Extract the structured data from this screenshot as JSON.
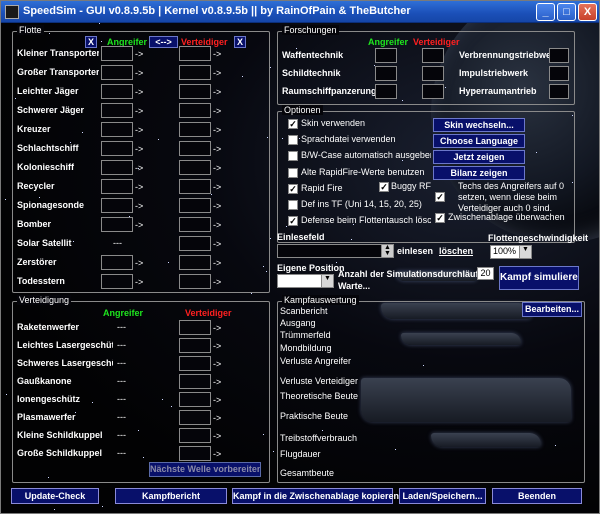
{
  "window": {
    "title": "SpeedSim - GUI v0.8.9.5b | Kernel v0.8.9.5b  ||  by RainOfPain & TheButcher",
    "min": "_",
    "max": "□",
    "close": "X"
  },
  "flotte": {
    "legend": "Flotte",
    "x_att": "X",
    "swap": "<-->",
    "x_def": "X",
    "att": "Angreifer",
    "def": "Verteidiger",
    "arrow": "->",
    "placeholder": "---",
    "ships": [
      "Kleiner Transporter",
      "Großer Transporter",
      "Leichter Jäger",
      "Schwerer Jäger",
      "Kreuzer",
      "Schlachtschiff",
      "Kolonieschiff",
      "Recycler",
      "Spionagesonde",
      "Bomber",
      "Solar Satellit",
      "Zerstörer",
      "Todesstern"
    ]
  },
  "forschung": {
    "legend": "Forschungen",
    "att": "Angreifer",
    "def": "Verteidiger",
    "left": [
      "Waffentechnik",
      "Schildtechnik",
      "Raumschiffpanzerung"
    ],
    "right": [
      "Verbrennungstriebwerk",
      "Impulstriebwerk",
      "Hyperraumantrieb"
    ]
  },
  "optionen": {
    "legend": "Optionen",
    "items": [
      {
        "label": "Skin verwenden",
        "checked": true
      },
      {
        "label": "Sprachdatei verwenden",
        "checked": false
      },
      {
        "label": "B/W-Case automatisch ausgeben",
        "checked": false
      },
      {
        "label": "Alte RapidFire-Werte benutzen",
        "checked": false
      },
      {
        "label": "Rapid Fire",
        "checked": true
      },
      {
        "label": "Def ins TF (Uni 14, 15, 20, 25)",
        "checked": false
      },
      {
        "label": "Defense beim Flottentausch löschen",
        "checked": true
      }
    ],
    "buggy": {
      "label": "Buggy RF",
      "checked": true
    },
    "techs": "Techs des Angreifers auf 0 setzen, wenn diese beim Verteidiger auch 0 sind.",
    "clip": "Zwischenablage überwachen",
    "buttons": [
      "Skin wechseln...",
      "Choose Language",
      "Jetzt zeigen",
      "Bilanz zeigen"
    ]
  },
  "einlesen": {
    "label": "Einlesefeld",
    "read": "einlesen",
    "clear": "löschen"
  },
  "speed": {
    "label": "Flottengeschwindigkeit",
    "value": "100%"
  },
  "eigene": {
    "label": "Eigene Position",
    "waves": "Anzahl der Simulationsdurchläufe",
    "waves_value": "20",
    "wait": "Warte..."
  },
  "simulate": "Kampf simulieren",
  "verteidigung": {
    "legend": "Verteidigung",
    "att": "Angreifer",
    "def": "Verteidiger",
    "arrow": "->",
    "placeholder": "---",
    "items": [
      "Raketenwerfer",
      "Leichtes Lasergeschütz",
      "Schweres Lasergeschütz",
      "Gaußkanone",
      "Ionengeschütz",
      "Plasmawerfer",
      "Kleine Schildkuppel",
      "Große Schildkuppel"
    ],
    "next_wave": "Nächste Welle vorbereiten"
  },
  "auswertung": {
    "legend": "Kampfauswertung",
    "edit": "Bearbeiten...",
    "rows": [
      "Scanbericht",
      "Ausgang",
      "Trümmerfeld",
      "Mondbildung",
      "Verluste Angreifer",
      "Verluste Verteidiger",
      "Theoretische Beute",
      "Praktische Beute",
      "Treibstoffverbrauch",
      "Flugdauer",
      "Gesamtbeute"
    ]
  },
  "bottom": [
    "Update-Check",
    "Kampfbericht",
    "Kampf in die Zwischenablage kopieren",
    "Laden/Speichern...",
    "Beenden"
  ]
}
